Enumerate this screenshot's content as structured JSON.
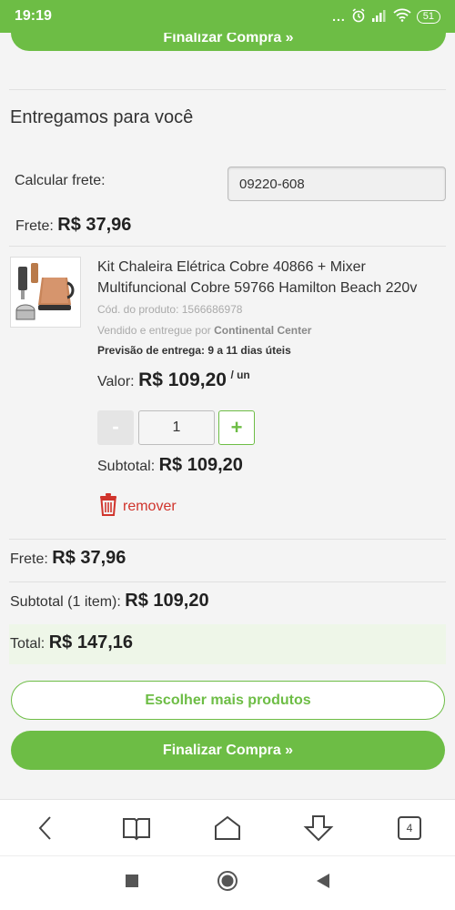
{
  "status_bar": {
    "time": "19:19",
    "dots": "...",
    "battery": "51"
  },
  "top_button": {
    "label": "Finalizar Compra »"
  },
  "section_title": "Entregamos para você",
  "frete_calc": {
    "label": "Calcular frete:",
    "cep_value": "09220-608"
  },
  "frete": {
    "label": "Frete:",
    "value": "R$ 37,96"
  },
  "product": {
    "name": "Kit Chaleira Elétrica Cobre 40866 + Mixer Multifuncional Cobre 59766 Hamilton Beach 220v",
    "code": "Cód. do produto: 1566686978",
    "sold_by_prefix": "Vendido e entregue por",
    "seller": "Continental Center",
    "delivery": "Previsão de entrega: 9 a 11 dias úteis",
    "price_label": "Valor:",
    "price": "R$ 109,20",
    "price_unit": "/ un",
    "qty_minus": "-",
    "quantity": "1",
    "qty_plus": "+",
    "subtotal_label": "Subtotal:",
    "subtotal": "R$ 109,20",
    "remove_label": "remover"
  },
  "summary": {
    "frete_label": "Frete:",
    "frete_value": "R$ 37,96",
    "subtotal_label": "Subtotal (1 item):",
    "subtotal_value": "R$ 109,20",
    "total_label": "Total:",
    "total_value": "R$ 147,16"
  },
  "buttons": {
    "more_products": "Escolher mais produtos",
    "checkout": "Finalizar Compra »"
  },
  "browser_nav": {
    "tabs_count": "4"
  },
  "colors": {
    "brand_green": "#6dbd45",
    "remove_red": "#d0342c",
    "total_bg": "#eef6e8"
  }
}
